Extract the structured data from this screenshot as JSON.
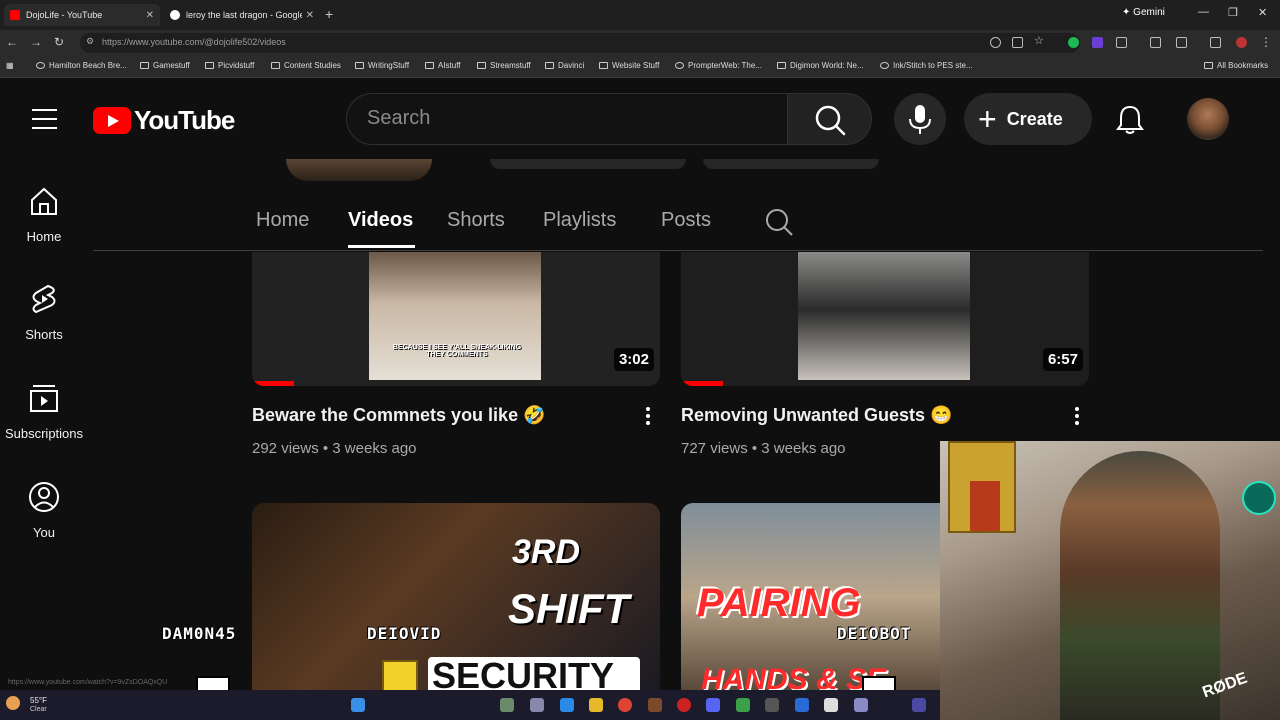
{
  "browser": {
    "tabs": [
      {
        "title": "DojoLife - YouTube",
        "favicon_color": "#ff0000",
        "active": true
      },
      {
        "title": "leroy the last dragon - Google",
        "favicon_color": "#ffffff",
        "active": false
      }
    ],
    "gemini_label": "Gemini",
    "url": "https://www.youtube.com/@dojolife502/videos",
    "bookmarks": [
      "Hamilton Beach Bre...",
      "Gamestuff",
      "Picvidstuff",
      "Content Studies",
      "WritingStuff",
      "AIstuff",
      "Streamstuff",
      "Davinci",
      "Website Stuff",
      "PrompterWeb: The...",
      "Digimon World: Ne...",
      "Ink/Stitch to PES ste...",
      "All Bookmarks"
    ]
  },
  "youtube": {
    "logo_text": "YouTube",
    "search_placeholder": "Search",
    "create_label": "Create"
  },
  "sidebar": [
    {
      "label": "Home",
      "icon": "home-icon"
    },
    {
      "label": "Shorts",
      "icon": "shorts-icon"
    },
    {
      "label": "Subscriptions",
      "icon": "subscriptions-icon"
    },
    {
      "label": "You",
      "icon": "you-icon"
    }
  ],
  "channel_tabs": [
    "Home",
    "Videos",
    "Shorts",
    "Playlists",
    "Posts"
  ],
  "active_tab": "Videos",
  "videos": [
    {
      "title": "Beware the Commnets you like 🤣",
      "meta": "292 views • 3 weeks ago",
      "duration": "3:02",
      "thumb_caption": "BECAUSE I SEE Y'ALL SNEAK-LIKING THEY COMMENTS",
      "watched": 0.1
    },
    {
      "title": "Removing Unwanted Guests 😁",
      "meta": "727 views • 3 weeks ago",
      "duration": "6:57",
      "watched": 0.1
    },
    {
      "title": "",
      "thumb_text": [
        "3RD",
        "SHIFT",
        "SECURITY"
      ]
    },
    {
      "title": "",
      "thumb_text": [
        "PAIRING",
        "HANDS & SE"
      ]
    }
  ],
  "overlay": {
    "names": [
      "DAM0N45",
      "DEIOVID",
      "DEIOBOT"
    ],
    "status_url": "https://www.youtube.com/watch?v=9vZsDOAQxQU",
    "weather": {
      "temp": "55°F",
      "cond": "Clear"
    }
  }
}
